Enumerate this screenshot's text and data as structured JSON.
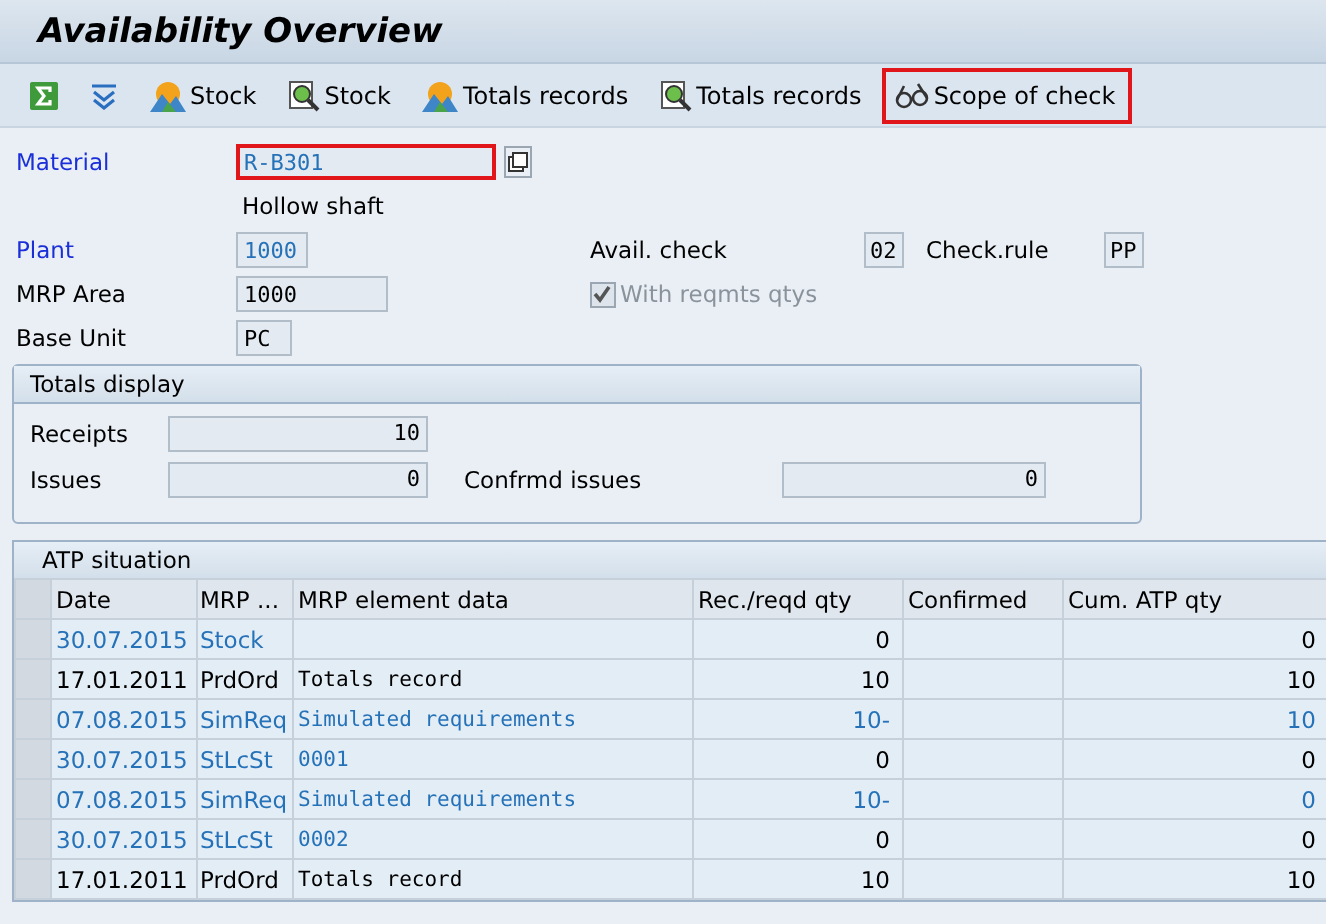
{
  "title": "Availability Overview",
  "toolbar": [
    {
      "kind": "sum"
    },
    {
      "kind": "expand"
    },
    {
      "kind": "mountain",
      "label": "Stock",
      "highlighted": false
    },
    {
      "kind": "lens",
      "label": "Stock",
      "highlighted": false
    },
    {
      "kind": "mountain",
      "label": "Totals records",
      "highlighted": false
    },
    {
      "kind": "lens",
      "label": "Totals records",
      "highlighted": false
    },
    {
      "kind": "glasses",
      "label": "Scope of check",
      "highlighted": true
    }
  ],
  "material": {
    "label": "Material",
    "value": "R-B301",
    "focused": true,
    "description": "Hollow shaft"
  },
  "plant": {
    "label": "Plant",
    "value": "1000"
  },
  "mrp_area": {
    "label": "MRP Area",
    "value": "1000"
  },
  "base_unit": {
    "label": "Base Unit",
    "value": "PC"
  },
  "avail_check": {
    "label": "Avail. check",
    "value": "02"
  },
  "check_rule": {
    "label": "Check.rule",
    "value": "PP"
  },
  "with_reqmts": {
    "label": "With reqmts qtys",
    "checked": true,
    "disabled": true
  },
  "totals": {
    "title": "Totals display",
    "receipts": {
      "label": "Receipts",
      "value": "10"
    },
    "issues": {
      "label": "Issues",
      "value": "0"
    },
    "confirmed_issues": {
      "label": "Confrmd issues",
      "value": "0"
    }
  },
  "atp": {
    "title": "ATP situation",
    "columns": [
      "Date",
      "MRP ...",
      "MRP element data",
      "Rec./reqd qty",
      "Confirmed",
      "Cum. ATP qty"
    ],
    "rows": [
      {
        "kind": "stock",
        "cells": [
          "30.07.2015",
          "Stock",
          "",
          "0",
          "",
          "0"
        ]
      },
      {
        "kind": "receipt",
        "cells": [
          "17.01.2011",
          "PrdOrd",
          "Totals record",
          "10",
          "",
          "10"
        ]
      },
      {
        "kind": "requirement",
        "cells": [
          "07.08.2015",
          "SimReq",
          "Simulated requirements",
          "10-",
          "",
          "10"
        ]
      },
      {
        "kind": "stock",
        "cells": [
          "30.07.2015",
          "StLcSt",
          "0001",
          "0",
          "",
          "0"
        ]
      },
      {
        "kind": "requirement",
        "cells": [
          "07.08.2015",
          "SimReq",
          "Simulated requirements",
          "10-",
          "",
          "0"
        ]
      },
      {
        "kind": "stock",
        "cells": [
          "30.07.2015",
          "StLcSt",
          "0002",
          "0",
          "",
          "0"
        ]
      },
      {
        "kind": "receipt",
        "cells": [
          "17.01.2011",
          "PrdOrd",
          "Totals record",
          "10",
          "",
          "10"
        ]
      }
    ]
  }
}
